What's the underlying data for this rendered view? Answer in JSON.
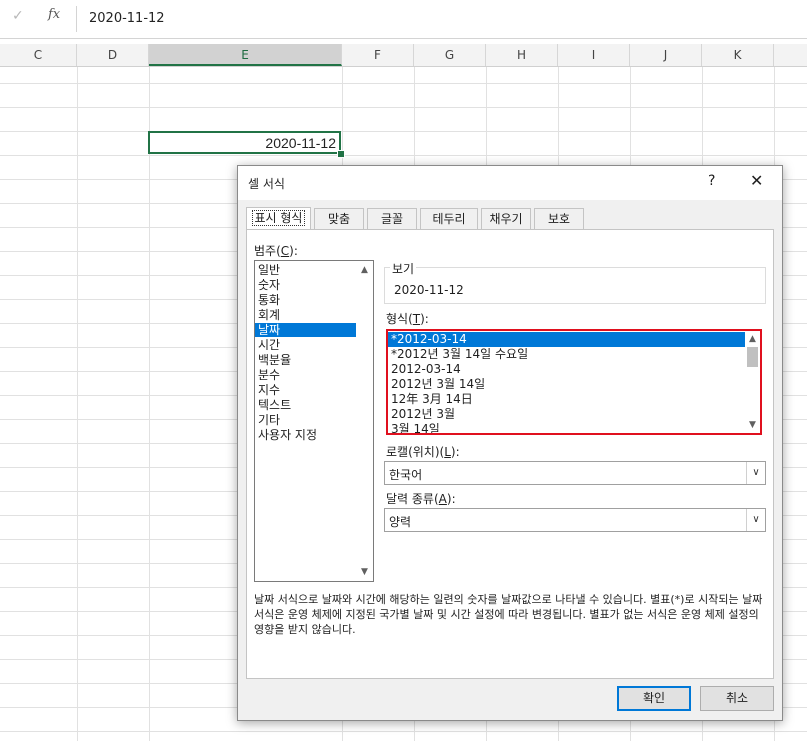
{
  "formula_bar": {
    "check_icon": "check-icon",
    "fx_label": "fx",
    "value": "2020-11-12"
  },
  "columns": [
    "C",
    "D",
    "E",
    "F",
    "G",
    "H",
    "I",
    "J",
    "K"
  ],
  "selected_column": "E",
  "active_cell_value": "2020-11-12",
  "dialog": {
    "title": "셀 서식",
    "help": "?",
    "close": "✕",
    "tabs": [
      "표시 형식",
      "맞춤",
      "글꼴",
      "테두리",
      "채우기",
      "보호"
    ],
    "active_tab": "표시 형식",
    "category_label": "범주(",
    "category_key": "C",
    "category_label_end": "):",
    "categories": [
      "일반",
      "숫자",
      "통화",
      "회계",
      "날짜",
      "시간",
      "백분율",
      "분수",
      "지수",
      "텍스트",
      "기타",
      "사용자 지정"
    ],
    "selected_category": "날짜",
    "sample_label": "보기",
    "sample_value": "2020-11-12",
    "format_label": "형식(",
    "format_key": "T",
    "format_label_end": "):",
    "formats": [
      "*2012-03-14",
      "*2012년 3월 14일 수요일",
      "2012-03-14",
      "2012년 3월 14일",
      "12年 3月 14日",
      "2012년 3월",
      "3월 14일"
    ],
    "selected_format": "*2012-03-14",
    "locale_label": "로캘(위치)(",
    "locale_key": "L",
    "locale_label_end": "):",
    "locale_value": "한국어",
    "calendar_label": "달력 종류(",
    "calendar_key": "A",
    "calendar_label_end": "):",
    "calendar_value": "양력",
    "description": "날짜 서식으로 날짜와 시간에 해당하는 일련의 숫자를 날짜값으로 나타낼 수 있습니다. 별표(*)로 시작되는 날짜 서식은 운영 체제에 지정된 국가별 날짜 및 시간 설정에 따라 변경됩니다. 별표가 없는 서식은 운영 체제 설정의 영향을 받지 않습니다.",
    "ok_button": "확인",
    "cancel_button": "취소"
  },
  "colors": {
    "excel_green": "#217346",
    "selection_blue": "#0078d7",
    "highlight_red": "#e0101e"
  }
}
